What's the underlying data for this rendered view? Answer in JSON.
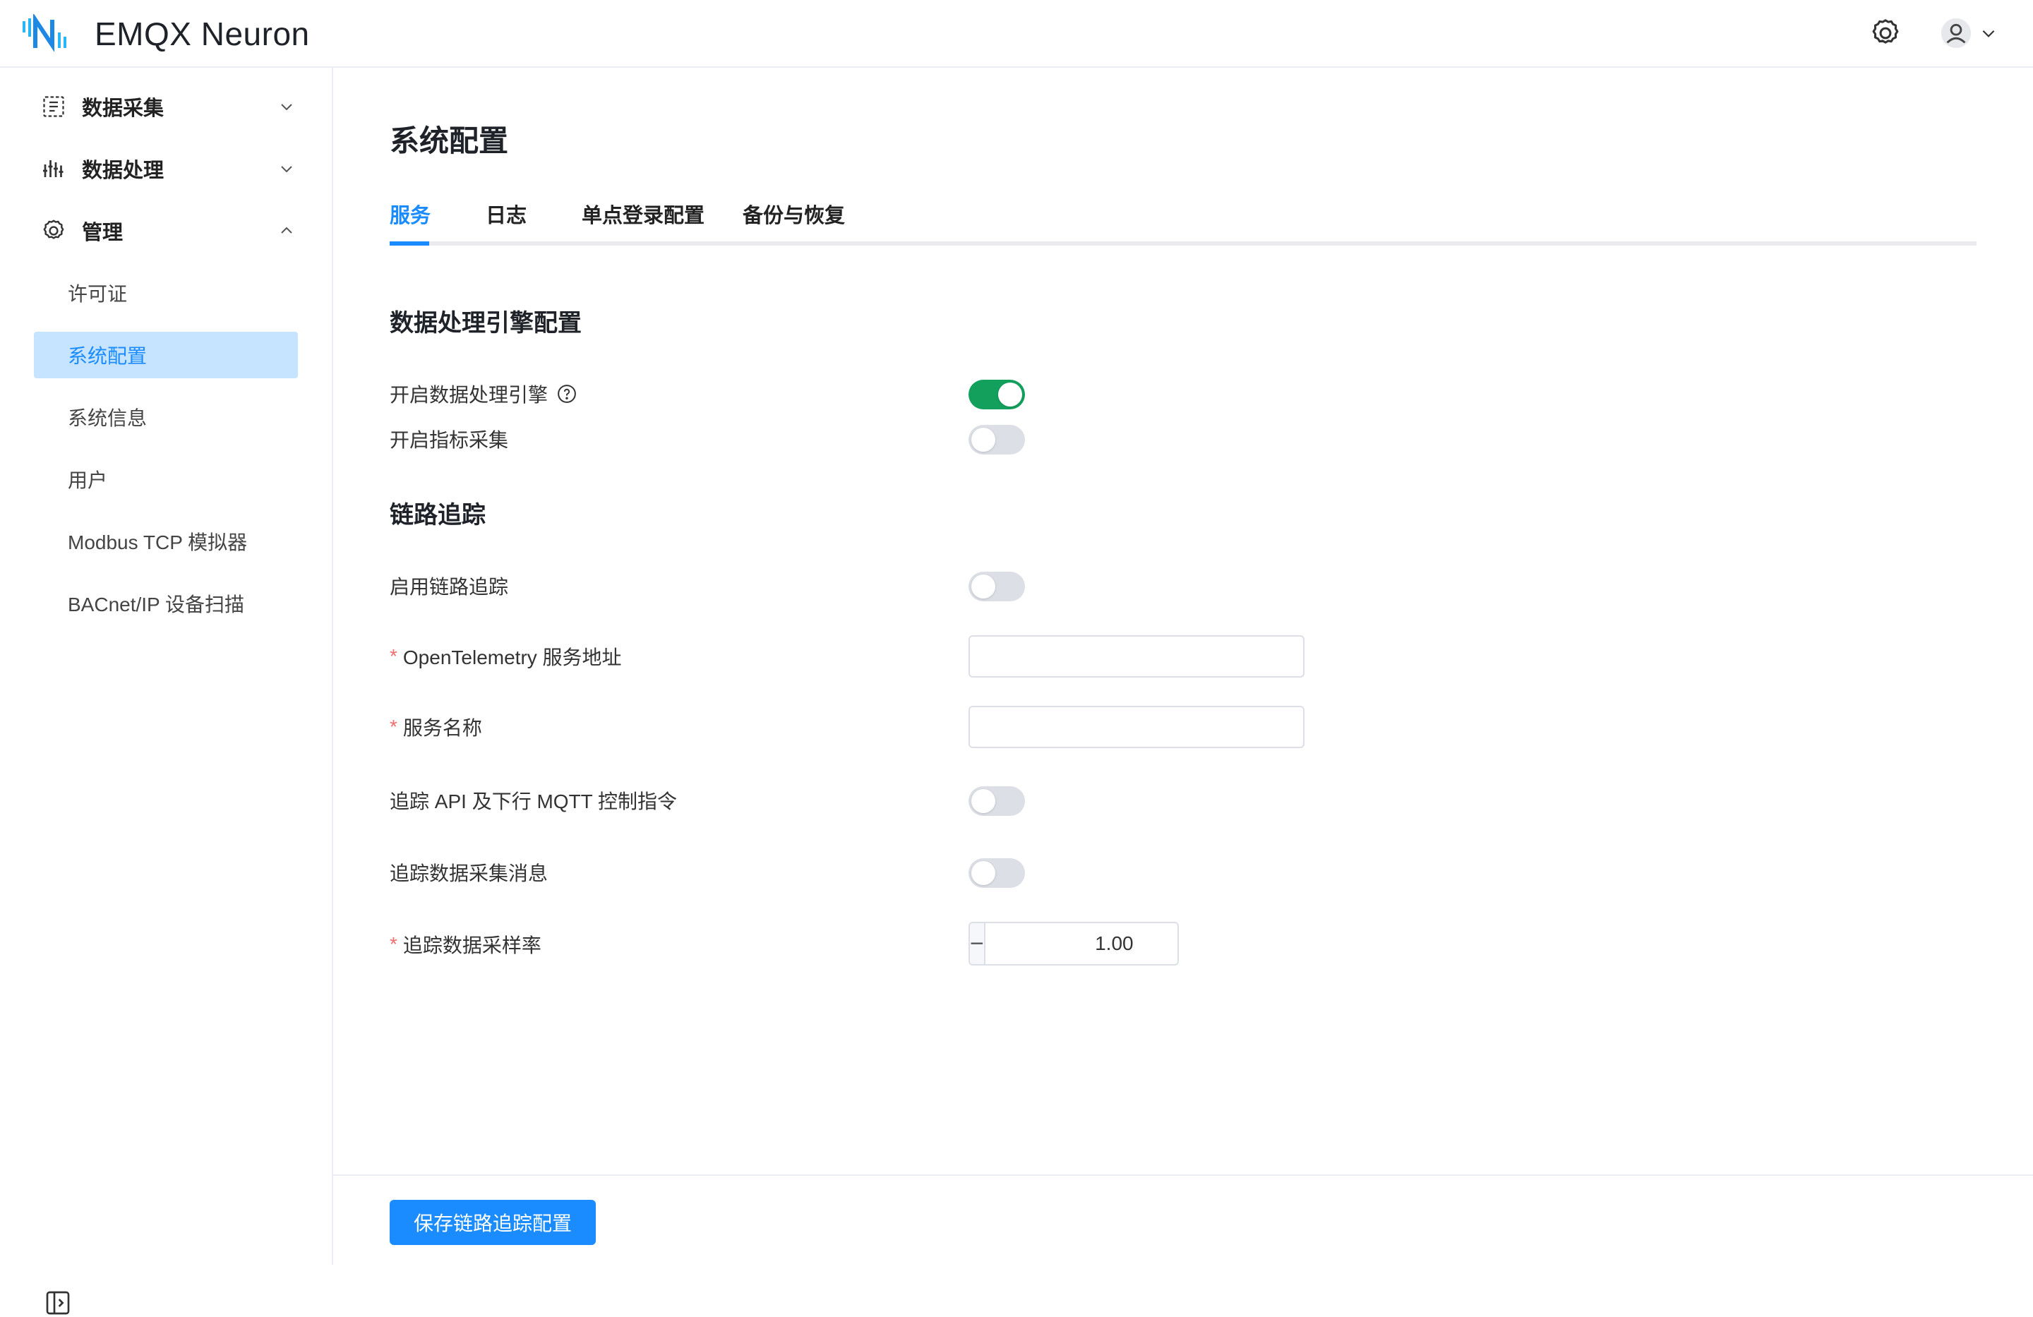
{
  "app": {
    "name": "EMQX Neuron"
  },
  "header": {
    "icons": [
      "gear-icon",
      "user-avatar-icon",
      "chevron-down-icon"
    ]
  },
  "sidebar": {
    "groups": [
      {
        "label": "数据采集",
        "icon": "data-collection-icon",
        "expanded": false
      },
      {
        "label": "数据处理",
        "icon": "data-processing-icon",
        "expanded": false
      },
      {
        "label": "管理",
        "icon": "gear-icon",
        "expanded": true
      }
    ],
    "items": [
      {
        "label": "许可证",
        "active": false
      },
      {
        "label": "系统配置",
        "active": true
      },
      {
        "label": "系统信息",
        "active": false
      },
      {
        "label": "用户",
        "active": false
      },
      {
        "label": "Modbus TCP 模拟器",
        "active": false
      },
      {
        "label": "BACnet/IP 设备扫描",
        "active": false
      }
    ],
    "collapse_icon": "sidebar-collapse-icon"
  },
  "page": {
    "title": "系统配置",
    "tabs": [
      "服务",
      "日志",
      "单点登录配置",
      "备份与恢复"
    ],
    "active_tab": "服务"
  },
  "engine_section": {
    "title": "数据处理引擎配置",
    "enable_engine": {
      "label": "开启数据处理引擎",
      "value": true
    },
    "enable_metrics": {
      "label": "开启指标采集",
      "value": false
    }
  },
  "tracing_section": {
    "title": "链路追踪",
    "enable_tracing": {
      "label": "启用链路追踪",
      "value": false
    },
    "otel_address": {
      "label": "OpenTelemetry 服务地址",
      "required": true,
      "value": ""
    },
    "service_name": {
      "label": "服务名称",
      "required": true,
      "value": ""
    },
    "trace_api": {
      "label": "追踪 API 及下行 MQTT 控制指令",
      "value": false
    },
    "trace_collect": {
      "label": "追踪数据采集消息",
      "value": false
    },
    "sample_rate": {
      "label": "追踪数据采样率",
      "required": true,
      "value": "1.00"
    }
  },
  "colors": {
    "accent": "#1a8cff",
    "switch_on": "#13a05d",
    "active_bg": "#c6e4ff",
    "required": "#f56c6c"
  },
  "footer": {
    "save_label": "保存链路追踪配置"
  }
}
